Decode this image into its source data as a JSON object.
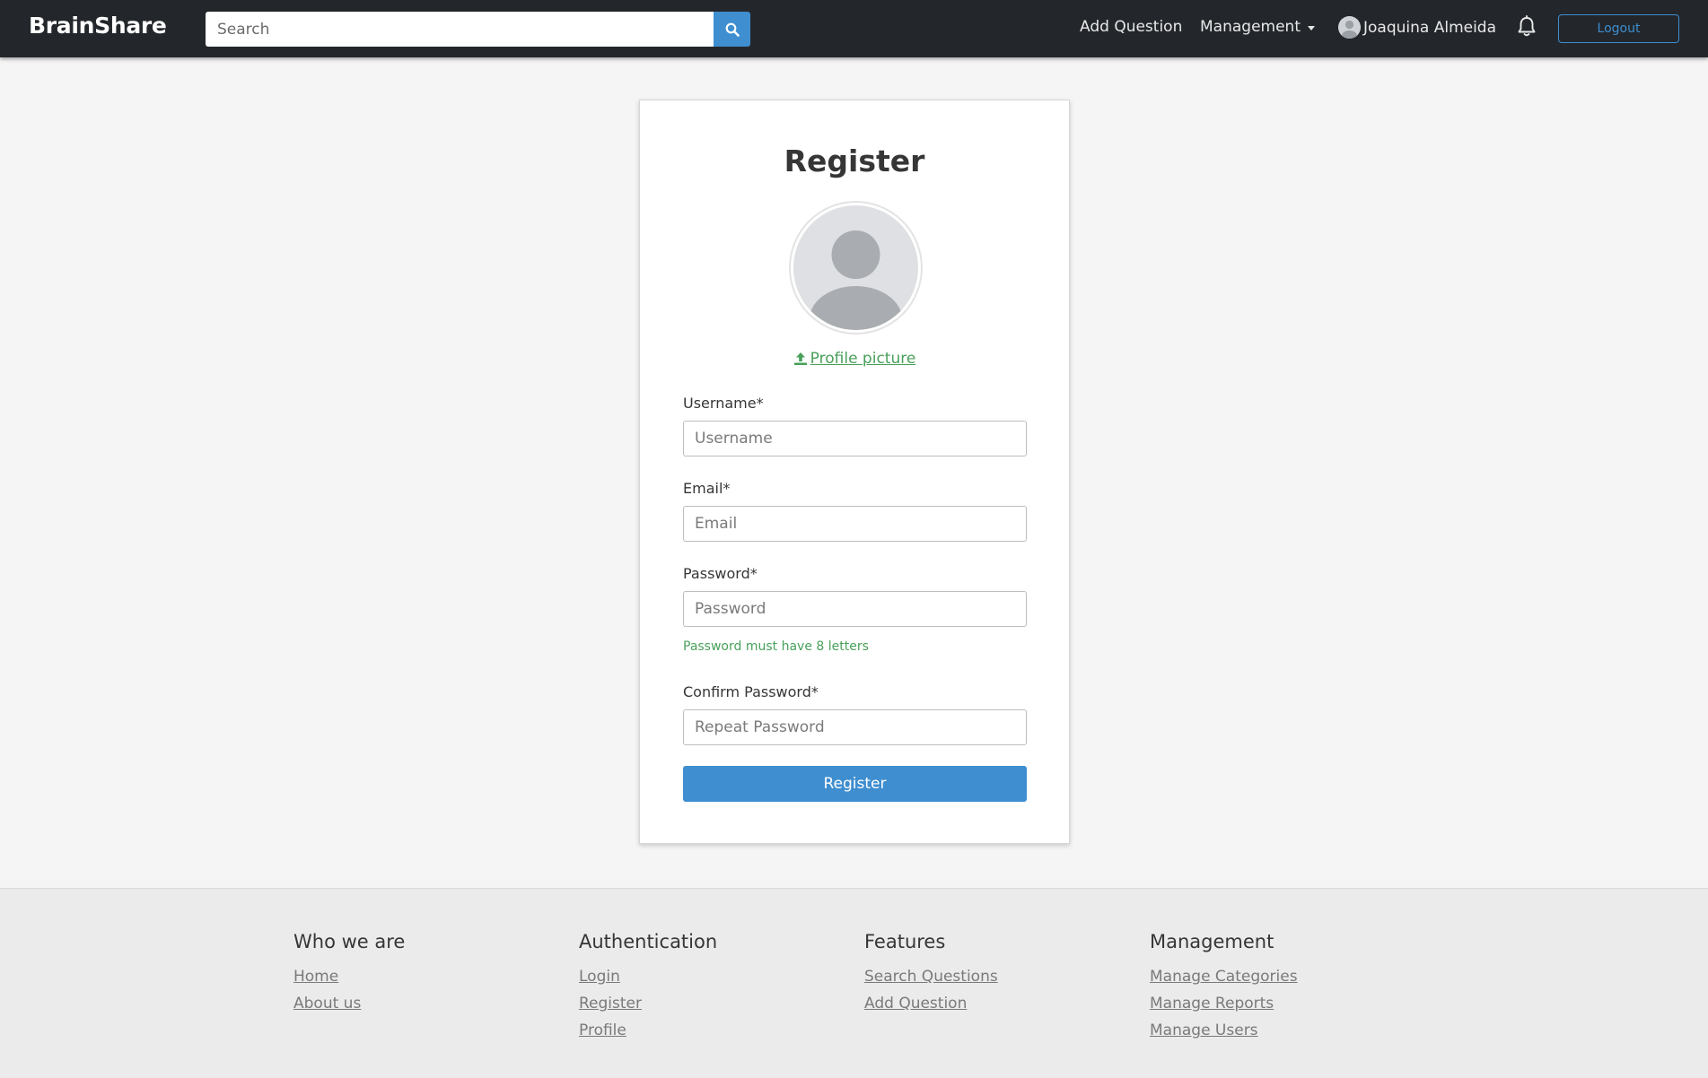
{
  "navbar": {
    "brand": "BrainShare",
    "search_placeholder": "Search",
    "add_question": "Add Question",
    "management": "Management",
    "user_name": "Joaquina Almeida",
    "logout": "Logout"
  },
  "register": {
    "title": "Register",
    "upload_label": "Profile picture",
    "username_label": "Username*",
    "username_placeholder": "Username",
    "email_label": "Email*",
    "email_placeholder": "Email",
    "password_label": "Password*",
    "password_placeholder": "Password",
    "password_hint": "Password must have 8 letters",
    "confirm_label": "Confirm Password*",
    "confirm_placeholder": "Repeat Password",
    "submit": "Register"
  },
  "footer": {
    "who": {
      "title": "Who we are",
      "links": [
        "Home",
        "About us"
      ]
    },
    "auth": {
      "title": "Authentication",
      "links": [
        "Login",
        "Register",
        "Profile"
      ]
    },
    "features": {
      "title": "Features",
      "links": [
        "Search Questions",
        "Add Question"
      ]
    },
    "management": {
      "title": "Management",
      "links": [
        "Manage Categories",
        "Manage Reports",
        "Manage Users"
      ]
    }
  },
  "colors": {
    "navbar_bg": "#23272b",
    "primary": "#3e8ed0",
    "success": "#48a05a",
    "page_bg": "#f5f5f5",
    "footer_bg": "#ebebeb"
  },
  "icons": [
    "search-icon",
    "caret-down-icon",
    "user-avatar-icon",
    "bell-icon",
    "upload-icon",
    "profile-placeholder-icon"
  ]
}
